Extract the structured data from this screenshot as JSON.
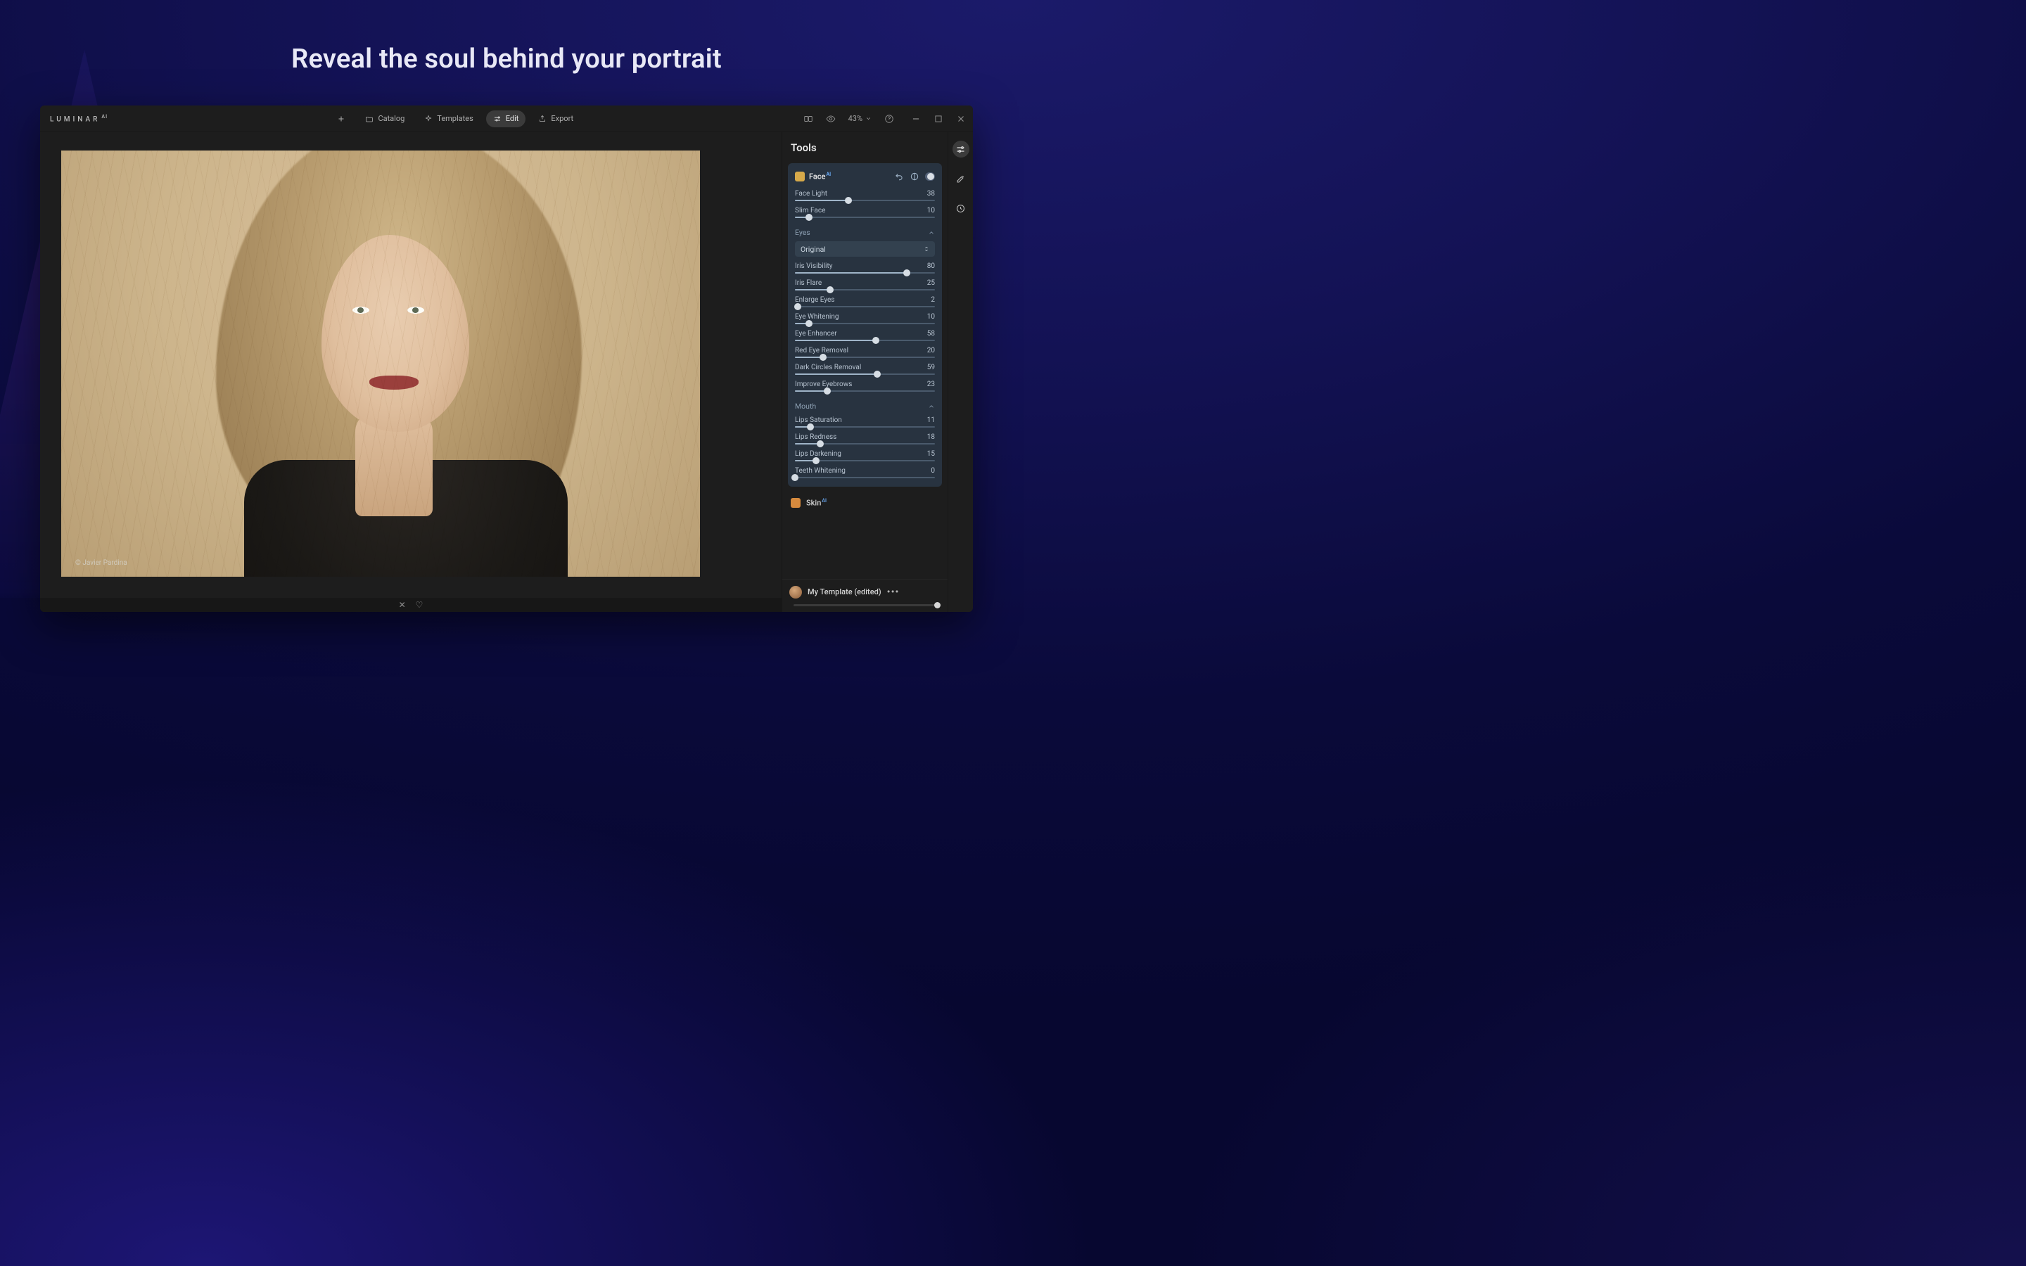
{
  "headline": "Reveal the soul behind your portrait",
  "brand": "LUMINAR",
  "brand_suffix": "AI",
  "nav": {
    "add_label": "",
    "catalog": "Catalog",
    "templates": "Templates",
    "edit": "Edit",
    "export": "Export"
  },
  "top_right": {
    "zoom": "43%"
  },
  "panel": {
    "title": "Tools",
    "face": {
      "title": "Face",
      "ai_badge": "AI",
      "face_light": {
        "label": "Face Light",
        "value": 38,
        "max": 100
      },
      "slim_face": {
        "label": "Slim Face",
        "value": 10,
        "max": 100
      },
      "eyes": {
        "heading": "Eyes",
        "preset": "Original",
        "iris_visibility": {
          "label": "Iris Visibility",
          "value": 80,
          "max": 100
        },
        "iris_flare": {
          "label": "Iris Flare",
          "value": 25,
          "max": 100
        },
        "enlarge_eyes": {
          "label": "Enlarge Eyes",
          "value": 2,
          "max": 100
        },
        "eye_whitening": {
          "label": "Eye Whitening",
          "value": 10,
          "max": 100
        },
        "eye_enhancer": {
          "label": "Eye Enhancer",
          "value": 58,
          "max": 100
        },
        "red_eye_removal": {
          "label": "Red Eye Removal",
          "value": 20,
          "max": 100
        },
        "dark_circles_removal": {
          "label": "Dark Circles Removal",
          "value": 59,
          "max": 100
        },
        "improve_eyebrows": {
          "label": "Improve Eyebrows",
          "value": 23,
          "max": 100
        }
      },
      "mouth": {
        "heading": "Mouth",
        "lips_saturation": {
          "label": "Lips Saturation",
          "value": 11,
          "max": 100
        },
        "lips_redness": {
          "label": "Lips Redness",
          "value": 18,
          "max": 100
        },
        "lips_darkening": {
          "label": "Lips Darkening",
          "value": 15,
          "max": 100
        },
        "teeth_whitening": {
          "label": "Teeth Whitening",
          "value": 0,
          "max": 100
        }
      }
    },
    "skin": {
      "title": "Skin",
      "ai_badge": "AI"
    },
    "template": {
      "label": "My Template (edited)"
    }
  },
  "watermark": "© Javier Pardina"
}
